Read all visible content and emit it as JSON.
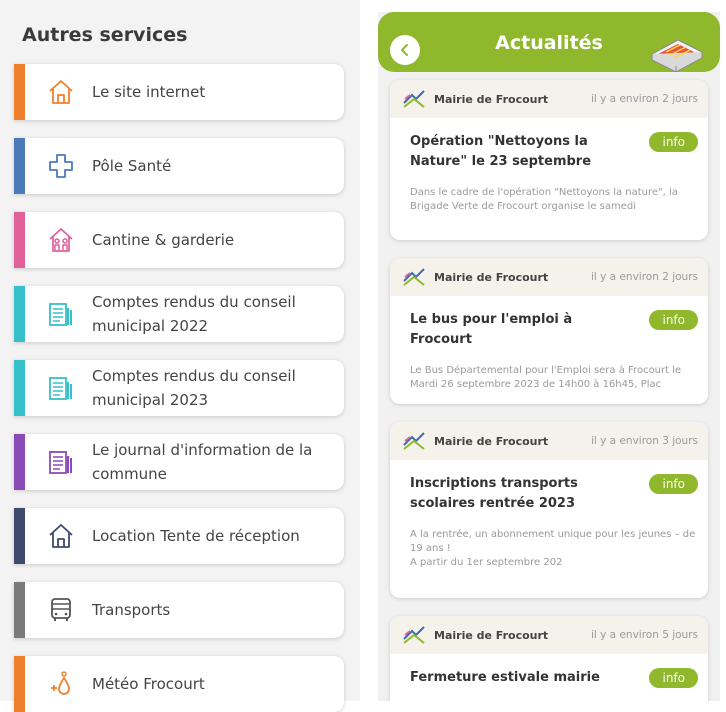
{
  "left": {
    "title": "Autres services",
    "services": [
      {
        "label": "Le site internet",
        "color": "#f07f2d",
        "icon": "house-icon"
      },
      {
        "label": "Pôle Santé",
        "color": "#4a7ab8",
        "icon": "medical-cross-icon"
      },
      {
        "label": "Cantine & garderie",
        "color": "#e0609a",
        "icon": "family-house-icon"
      },
      {
        "label": "Comptes rendus du conseil municipal 2022",
        "color": "#36c0c9",
        "icon": "document-icon"
      },
      {
        "label": "Comptes rendus du conseil municipal 2023",
        "color": "#36c0c9",
        "icon": "document-icon"
      },
      {
        "label": "Le journal d'information de la commune",
        "color": "#8a4ab8",
        "icon": "document-icon"
      },
      {
        "label": "Location Tente de réception",
        "color": "#3d4a6b",
        "icon": "house-icon"
      },
      {
        "label": "Transports",
        "color": "#7a7a7a",
        "icon": "bus-icon"
      },
      {
        "label": "Météo Frocourt",
        "color": "#f07f2d",
        "icon": "weather-drops-icon"
      }
    ]
  },
  "right": {
    "title": "Actualités",
    "accent": "#8fb82c",
    "news": [
      {
        "source": "Mairie de Frocourt",
        "time": "il y a environ 2 jours",
        "title": "Opération \"Nettoyons la Nature\" le 23 septembre",
        "badge": "info",
        "text": "Dans le cadre de l'opération \"Nettoyons la nature\", la Brigade Verte de Frocourt organise le samedi"
      },
      {
        "source": "Mairie de Frocourt",
        "time": "il y a environ 2 jours",
        "title": "Le bus pour l'emploi à Frocourt",
        "badge": "info",
        "text": "Le Bus Départemental pour l'Emploi sera à Frocourt le Mardi 26 septembre 2023 de 14h00 à 16h45, Plac"
      },
      {
        "source": "Mairie de Frocourt",
        "time": "il y a environ 3 jours",
        "title": "Inscriptions transports scolaires rentrée 2023",
        "badge": "info",
        "text": "A la rentrée, un abonnement unique pour les jeunes – de 19 ans !\nA partir du 1er septembre 202"
      },
      {
        "source": "Mairie de Frocourt",
        "time": "il y a environ 5 jours",
        "title": "Fermeture estivale mairie",
        "badge": "info",
        "text": ""
      }
    ]
  }
}
